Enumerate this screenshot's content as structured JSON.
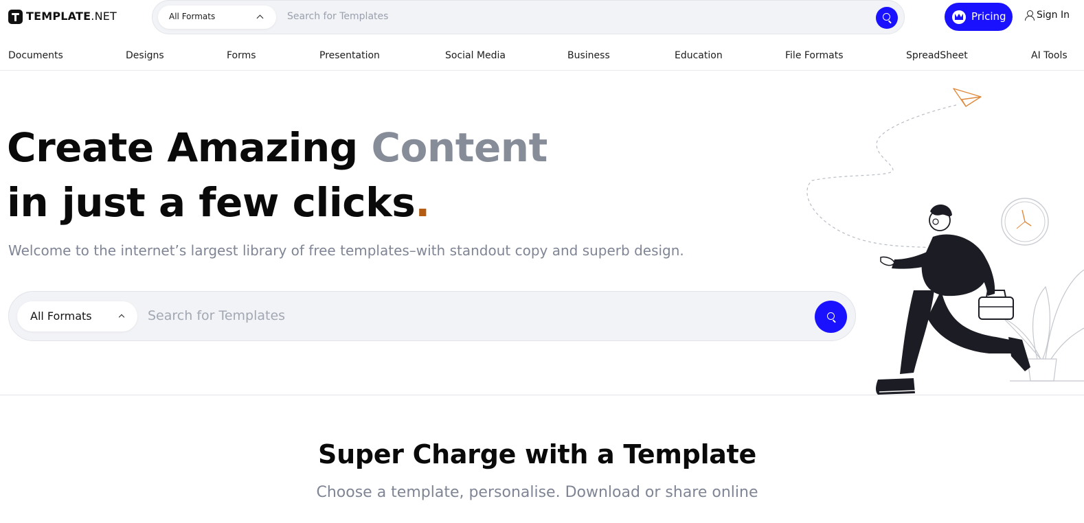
{
  "header": {
    "logo": {
      "bold": "TEMPLATE",
      "light": ".NET"
    },
    "search": {
      "format_label": "All Formats",
      "placeholder": "Search for Templates"
    },
    "pricing_label": "Pricing",
    "signin_label": "Sign In"
  },
  "nav": {
    "items": [
      "Documents",
      "Designs",
      "Forms",
      "Presentation",
      "Social Media",
      "Business",
      "Education",
      "File Formats",
      "SpreadSheet",
      "AI Tools"
    ]
  },
  "hero": {
    "headline_part1": "Create Amazing ",
    "headline_accent": "Content",
    "headline_line2": "in just a few clicks",
    "headline_dot": ".",
    "subheadline": "Welcome to the internet’s largest library of free templates–with standout copy and superb design.",
    "search": {
      "format_label": "All Formats",
      "placeholder": "Search for Templates"
    },
    "illustration_icon": "man-walking-with-briefcase-illustration"
  },
  "section": {
    "title": "Super Charge with a Template",
    "subtitle": "Choose a template, personalise. Download or share online"
  },
  "colors": {
    "brand_blue": "#1a12ff",
    "accent_gray": "#878c99",
    "dot_orange": "#b35c12",
    "search_bg": "#f2f3f6"
  }
}
